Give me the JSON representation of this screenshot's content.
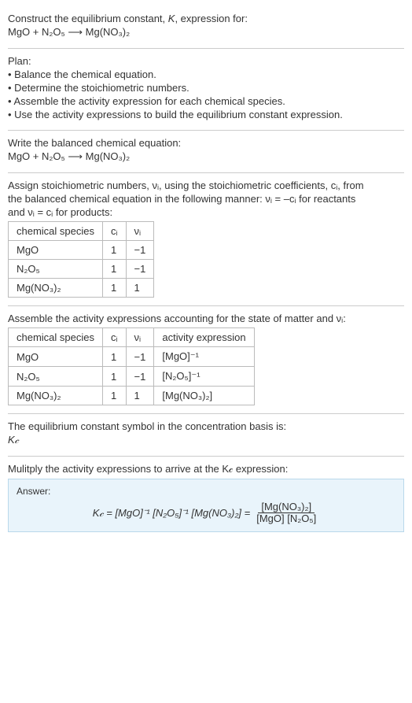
{
  "prompt": {
    "line1": "Construct the equilibrium constant, K, expression for:",
    "equation": "MgO + N₂O₅  ⟶  Mg(NO₃)₂"
  },
  "plan": {
    "heading": "Plan:",
    "items": [
      "• Balance the chemical equation.",
      "• Determine the stoichiometric numbers.",
      "• Assemble the activity expression for each chemical species.",
      "• Use the activity expressions to build the equilibrium constant expression."
    ]
  },
  "balanced": {
    "heading": "Write the balanced chemical equation:",
    "equation": "MgO + N₂O₅  ⟶  Mg(NO₃)₂"
  },
  "stoich": {
    "intro1": "Assign stoichiometric numbers, νᵢ, using the stoichiometric coefficients, cᵢ, from",
    "intro2": "the balanced chemical equation in the following manner: νᵢ = –cᵢ for reactants",
    "intro3": "and νᵢ = cᵢ for products:",
    "headers": {
      "species": "chemical species",
      "ci": "cᵢ",
      "vi": "νᵢ"
    },
    "rows": [
      {
        "species": "MgO",
        "ci": "1",
        "vi": "−1"
      },
      {
        "species": "N₂O₅",
        "ci": "1",
        "vi": "−1"
      },
      {
        "species": "Mg(NO₃)₂",
        "ci": "1",
        "vi": "1"
      }
    ]
  },
  "activity": {
    "intro": "Assemble the activity expressions accounting for the state of matter and νᵢ:",
    "headers": {
      "species": "chemical species",
      "ci": "cᵢ",
      "vi": "νᵢ",
      "expr": "activity expression"
    },
    "rows": [
      {
        "species": "MgO",
        "ci": "1",
        "vi": "−1",
        "expr": "[MgO]⁻¹"
      },
      {
        "species": "N₂O₅",
        "ci": "1",
        "vi": "−1",
        "expr": "[N₂O₅]⁻¹"
      },
      {
        "species": "Mg(NO₃)₂",
        "ci": "1",
        "vi": "1",
        "expr": "[Mg(NO₃)₂]"
      }
    ]
  },
  "symbol": {
    "intro": "The equilibrium constant symbol in the concentration basis is:",
    "value": "K𝒸"
  },
  "multiply": {
    "intro": "Mulitply the activity expressions to arrive at the K𝒸 expression:"
  },
  "answer": {
    "label": "Answer:",
    "lhs": "K𝒸 = [MgO]⁻¹ [N₂O₅]⁻¹ [Mg(NO₃)₂] =",
    "frac_num": "[Mg(NO₃)₂]",
    "frac_den": "[MgO] [N₂O₅]"
  },
  "chart_data": {
    "type": "table",
    "tables": [
      {
        "title": "Stoichiometric numbers",
        "columns": [
          "chemical species",
          "cᵢ",
          "νᵢ"
        ],
        "rows": [
          [
            "MgO",
            1,
            -1
          ],
          [
            "N₂O₅",
            1,
            -1
          ],
          [
            "Mg(NO₃)₂",
            1,
            1
          ]
        ]
      },
      {
        "title": "Activity expressions",
        "columns": [
          "chemical species",
          "cᵢ",
          "νᵢ",
          "activity expression"
        ],
        "rows": [
          [
            "MgO",
            1,
            -1,
            "[MgO]^-1"
          ],
          [
            "N₂O₅",
            1,
            -1,
            "[N₂O₅]^-1"
          ],
          [
            "Mg(NO₃)₂",
            1,
            1,
            "[Mg(NO₃)₂]"
          ]
        ]
      }
    ]
  }
}
